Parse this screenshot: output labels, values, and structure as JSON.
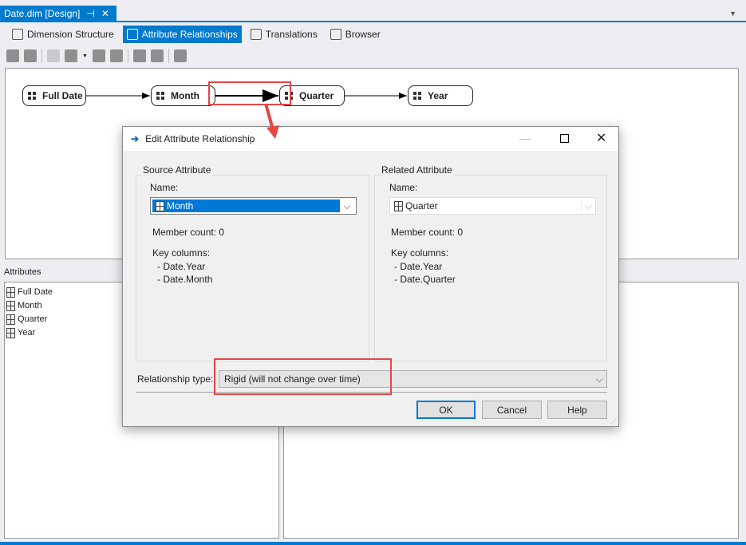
{
  "document_tab": {
    "title": "Date.dim [Design]",
    "pin": "⊣",
    "close": "✕"
  },
  "sub_tabs": [
    {
      "label": "Dimension Structure",
      "active": false
    },
    {
      "label": "Attribute Relationships",
      "active": true
    },
    {
      "label": "Translations",
      "active": false
    },
    {
      "label": "Browser",
      "active": false
    }
  ],
  "toolbar_icons": [
    "new-relationship-icon",
    "process-icon",
    "paste-icon",
    "zoom-icon",
    "expand-all-icon",
    "collapse-all-icon",
    "autoarrange-icon",
    "arrange-icon",
    "properties-icon"
  ],
  "diagram": {
    "nodes": [
      {
        "label": "Full Date",
        "icon": "key-attribute-icon"
      },
      {
        "label": "Month",
        "icon": "attribute-icon"
      },
      {
        "label": "Quarter",
        "icon": "attribute-icon"
      },
      {
        "label": "Year",
        "icon": "attribute-icon"
      }
    ]
  },
  "attributes_panel": {
    "title": "Attributes",
    "items": [
      "Full Date",
      "Month",
      "Quarter",
      "Year"
    ]
  },
  "dialog": {
    "title": "Edit Attribute Relationship",
    "source": {
      "group": "Source Attribute",
      "name_label": "Name:",
      "name": "Month",
      "member_count": "Member count: 0",
      "key_columns_label": "Key columns:",
      "key_columns": [
        "- Date.Year",
        "- Date.Month"
      ]
    },
    "related": {
      "group": "Related Attribute",
      "name_label": "Name:",
      "name": "Quarter",
      "member_count": "Member count: 0",
      "key_columns_label": "Key columns:",
      "key_columns": [
        "- Date.Year",
        "- Date.Quarter"
      ]
    },
    "relationship_type_label": "Relationship type:",
    "relationship_type": "Rigid (will not change over time)",
    "ok": "OK",
    "cancel": "Cancel",
    "help": "Help"
  },
  "colors": {
    "accent": "#007acc",
    "highlight": "#e84545"
  }
}
